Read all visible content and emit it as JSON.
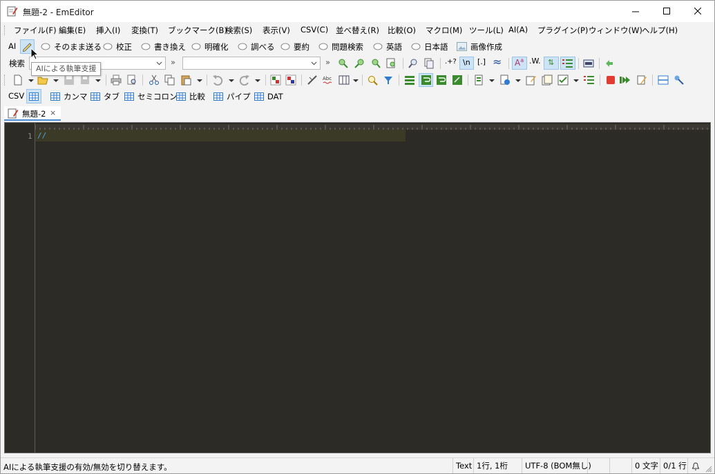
{
  "window": {
    "title": "無題-2 - EmEditor"
  },
  "menu": [
    "ファイル(F)",
    "編集(E)",
    "挿入(I)",
    "変換(T)",
    "ブックマーク(B)",
    "検索(S)",
    "表示(V)",
    "CSV(C)",
    "並べ替え(R)",
    "比較(O)",
    "マクロ(M)",
    "ツール(L)",
    "AI(A)",
    "プラグイン(P)",
    "ウィンドウ(W)",
    "ヘルプ(H)"
  ],
  "ai_toolbar": {
    "label": "AI",
    "buttons": [
      "そのまま送る",
      "校正",
      "書き換え",
      "明確化",
      "調べる",
      "要約",
      "問題検索",
      "英語",
      "日本語",
      "画像作成"
    ]
  },
  "search_toolbar": {
    "label": "検索",
    "find_value": "",
    "replace_value": "",
    "arrow": "»"
  },
  "csv_toolbar": {
    "label": "CSV",
    "buttons": [
      "カンマ",
      "タブ",
      "セミコロン",
      "比較",
      "パイプ",
      "DAT"
    ]
  },
  "tab": {
    "label": "無題-2",
    "close": "×"
  },
  "editor": {
    "line_number": "1",
    "content": "//"
  },
  "tooltip": "AIによる執筆支援",
  "status": {
    "message": "AIによる執筆支援の有効/無効を切り替えます。",
    "mode": "Text",
    "position": "1行, 1桁",
    "encoding": "UTF-8 (BOM無し)",
    "chars": "0 文字",
    "lines": "0/1 行"
  },
  "colors": {
    "accent": "#4c8bd6",
    "editor_bg": "#2d2b25",
    "current_line": "#3b3a26",
    "pressed": "#cde4f7"
  }
}
